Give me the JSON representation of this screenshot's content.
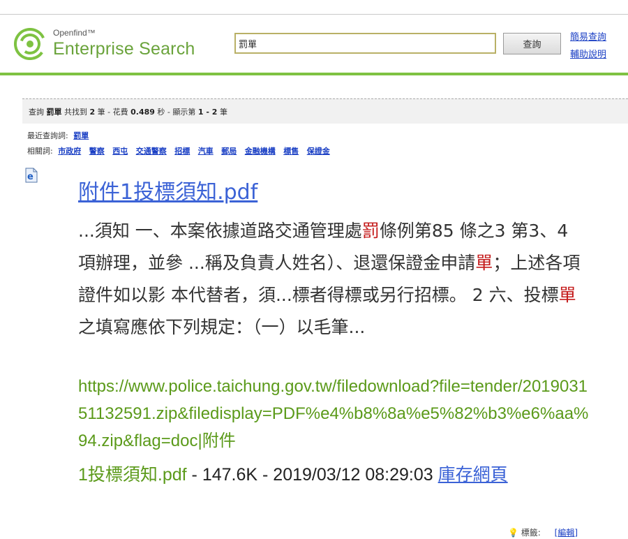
{
  "header": {
    "logo_small": "Openfind™",
    "logo_big": "Enterprise Search",
    "search_value": "罰單",
    "search_button": "查詢",
    "link_simple": "簡易查詢",
    "link_help": "輔助說明"
  },
  "info": {
    "prefix": "查詢",
    "query": "罰單",
    "found_prefix": "共找到",
    "count": "2",
    "found_suffix": "筆 - 花費",
    "time": "0.489",
    "time_suffix": "秒 - 顯示第",
    "range": "1 - 2",
    "range_suffix": "筆"
  },
  "recent": {
    "label": "最近查詢詞:",
    "keyword": "罰單"
  },
  "related": {
    "label": "相關詞:",
    "keywords": [
      "市政府",
      "警察",
      "西屯",
      "交通警察",
      "招標",
      "汽車",
      "郵局",
      "金融機構",
      "標售",
      "保證金"
    ]
  },
  "result": {
    "icon": "ie-document-icon",
    "title": "附件1投標須知.pdf",
    "snippet": {
      "s1": "...須知 一、本案依據道路交通管理處",
      "h1": "罰",
      "s2": "條例第85 條之3 第3、4 項辦理，並參 ...稱及負責人姓名）、退還保證金申請",
      "h2": "單",
      "s3": "；上述各項證件如以影 本代替者，須...標者得標或另行招標。 2 六、投標",
      "h3": "單",
      "s4": "之填寫應依下列規定：（一）以毛筆..."
    },
    "url": "https://www.police.taichung.gov.tw/filedownload?file=tender/201903151132591.zip&filedisplay=PDF%e4%b8%8a%e5%82%b3%e6%aa%94.zip&flag=doc|附件",
    "file": "1投標須知.pdf",
    "sep1": " - ",
    "size": "147.6K",
    "sep2": " - ",
    "date": "2019/03/12 08:29:03",
    "cache": "庫存網頁"
  },
  "tags": {
    "label": "標籤:",
    "edit": "[編輯]"
  },
  "colors": {
    "brand_green": "#7ec242",
    "link_blue": "#1a3fc4",
    "url_green": "#5b9a1a",
    "highlight_red": "#c41a1a"
  }
}
